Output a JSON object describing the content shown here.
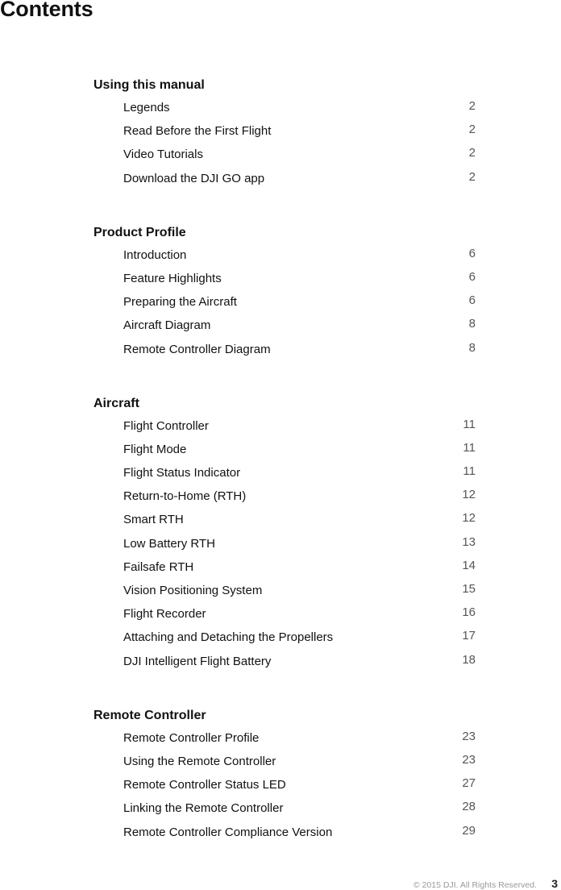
{
  "title": "Contents",
  "sections": [
    {
      "heading": "Using this manual",
      "entries": [
        {
          "label": "Legends",
          "page": "2"
        },
        {
          "label": "Read Before the First Flight",
          "page": "2"
        },
        {
          "label": "Video Tutorials",
          "page": "2"
        },
        {
          "label": "Download the DJI GO app",
          "page": "2"
        }
      ]
    },
    {
      "heading": "Product Profile",
      "entries": [
        {
          "label": "Introduction",
          "page": "6"
        },
        {
          "label": "Feature Highlights",
          "page": "6"
        },
        {
          "label": "Preparing the Aircraft",
          "page": "6"
        },
        {
          "label": "Aircraft Diagram",
          "page": "8"
        },
        {
          "label": "Remote Controller Diagram",
          "page": "8"
        }
      ]
    },
    {
      "heading": "Aircraft",
      "entries": [
        {
          "label": "Flight Controller",
          "page": "11"
        },
        {
          "label": "Flight Mode",
          "page": "11"
        },
        {
          "label": "Flight Status Indicator",
          "page": "11"
        },
        {
          "label": "Return-to-Home (RTH)",
          "page": "12"
        },
        {
          "label": "Smart RTH",
          "page": "12"
        },
        {
          "label": "Low Battery RTH",
          "page": "13"
        },
        {
          "label": "Failsafe RTH",
          "page": "14"
        },
        {
          "label": "Vision Positioning System",
          "page": "15"
        },
        {
          "label": "Flight Recorder",
          "page": "16"
        },
        {
          "label": "Attaching and Detaching the Propellers",
          "page": "17"
        },
        {
          "label": "DJI Intelligent Flight Battery",
          "page": "18"
        }
      ]
    },
    {
      "heading": "Remote Controller",
      "entries": [
        {
          "label": "Remote Controller Profile",
          "page": "23"
        },
        {
          "label": "Using the Remote Controller",
          "page": "23"
        },
        {
          "label": "Remote Controller Status LED",
          "page": "27"
        },
        {
          "label": "Linking the Remote Controller",
          "page": "28"
        },
        {
          "label": "Remote Controller Compliance Version",
          "page": "29"
        }
      ]
    }
  ],
  "footer": {
    "copyright": "© 2015 DJI. All Rights Reserved.",
    "page_number": "3"
  }
}
